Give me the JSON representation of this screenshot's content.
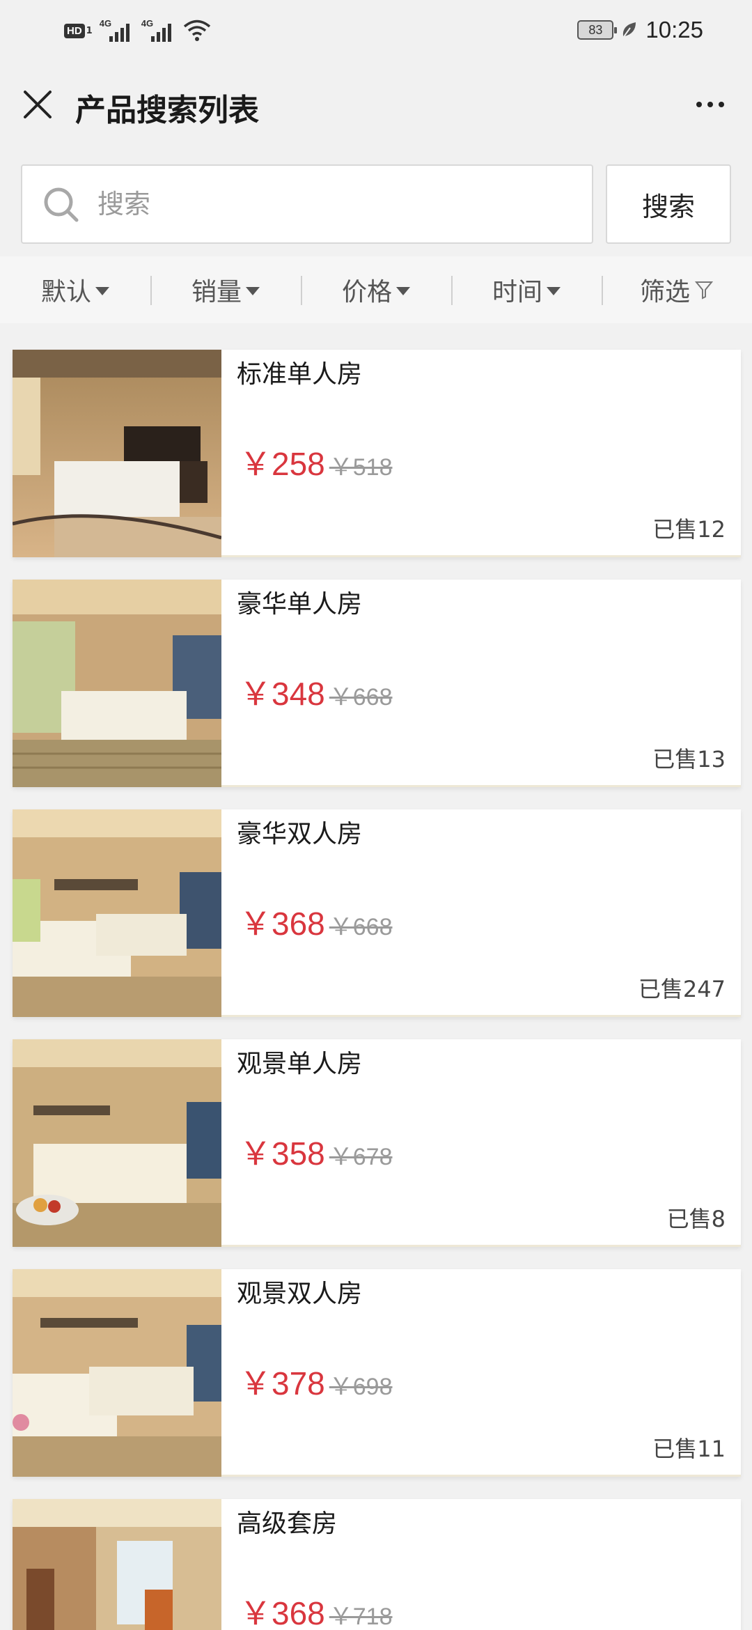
{
  "status_bar": {
    "hd": "HD",
    "sim": "1",
    "net1": "4G",
    "net2": "4G",
    "battery": "83",
    "time": "10:25"
  },
  "nav": {
    "title": "产品搜索列表"
  },
  "search": {
    "placeholder": "搜索",
    "value": "",
    "button_label": "搜索"
  },
  "filters": [
    {
      "label": "默认",
      "icon": "caret-down-icon"
    },
    {
      "label": "销量",
      "icon": "caret-down-icon"
    },
    {
      "label": "价格",
      "icon": "caret-down-icon"
    },
    {
      "label": "时间",
      "icon": "caret-down-icon"
    },
    {
      "label": "筛选",
      "icon": "funnel-icon"
    }
  ],
  "products": [
    {
      "name": "标准单人房",
      "price": "￥258",
      "original_price": "￥518",
      "sold": "已售12"
    },
    {
      "name": "豪华单人房",
      "price": "￥348",
      "original_price": "￥668",
      "sold": "已售13"
    },
    {
      "name": "豪华双人房",
      "price": "￥368",
      "original_price": "￥668",
      "sold": "已售247"
    },
    {
      "name": "观景单人房",
      "price": "￥358",
      "original_price": "￥678",
      "sold": "已售8"
    },
    {
      "name": "观景双人房",
      "price": "￥378",
      "original_price": "￥698",
      "sold": "已售11"
    },
    {
      "name": "高级套房",
      "price": "￥368",
      "original_price": "￥718",
      "sold": ""
    }
  ],
  "colors": {
    "price": "#d9363e",
    "background": "#f1f1f1"
  }
}
